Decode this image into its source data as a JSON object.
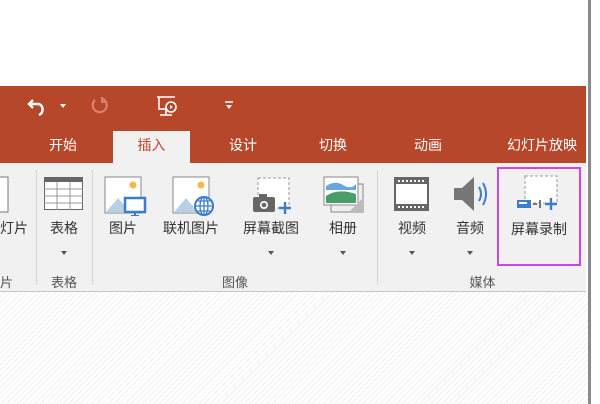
{
  "quick_access": {
    "undo": "undo-icon",
    "redo": "redo-icon",
    "present": "presenter-icon",
    "customize": "customize-icon"
  },
  "tabs": [
    {
      "label": "开始"
    },
    {
      "label": "插入"
    },
    {
      "label": "设计"
    },
    {
      "label": "切换"
    },
    {
      "label": "动画"
    },
    {
      "label": "幻灯片放映"
    }
  ],
  "groups": {
    "slides": {
      "button": "灯片",
      "label": "片"
    },
    "tables": {
      "label": "表格",
      "buttons": [
        "表格"
      ]
    },
    "images": {
      "label": "图像",
      "buttons": [
        "图片",
        "联机图片",
        "屏幕截图",
        "相册"
      ]
    },
    "media": {
      "label": "媒体",
      "buttons": [
        "视频",
        "音频",
        "屏幕录制"
      ]
    }
  },
  "colors": {
    "accent": "#b7472a",
    "highlight": "#cc44ee"
  }
}
